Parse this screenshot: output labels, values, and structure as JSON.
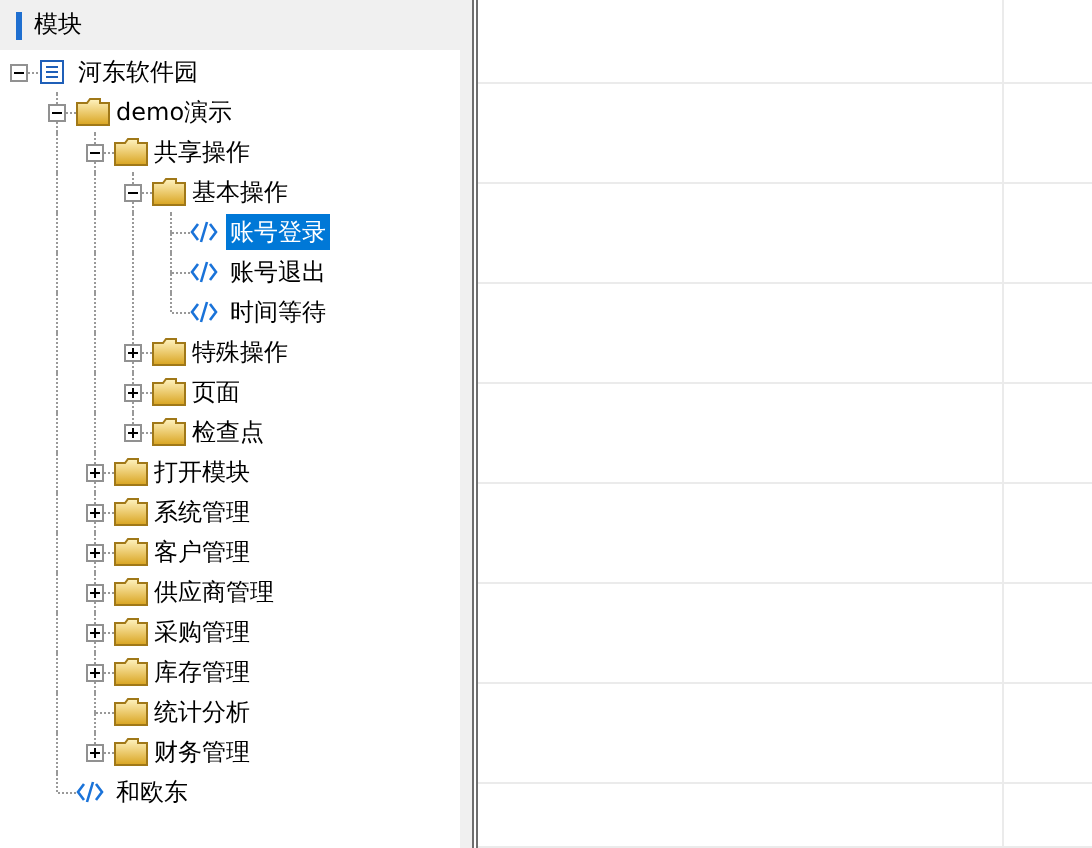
{
  "panel": {
    "title": "模块"
  },
  "tree": [
    {
      "label": "河东软件园",
      "kind": "list",
      "expanded": true,
      "selected": false,
      "children": [
        {
          "label": "demo演示",
          "kind": "folder",
          "expanded": true,
          "selected": false,
          "children": [
            {
              "label": "共享操作",
              "kind": "folder",
              "expanded": true,
              "selected": false,
              "children": [
                {
                  "label": "基本操作",
                  "kind": "folder",
                  "expanded": true,
                  "selected": false,
                  "children": [
                    {
                      "label": "账号登录",
                      "kind": "code",
                      "selected": true
                    },
                    {
                      "label": "账号退出",
                      "kind": "code",
                      "selected": false
                    },
                    {
                      "label": "时间等待",
                      "kind": "code",
                      "selected": false
                    }
                  ]
                },
                {
                  "label": "特殊操作",
                  "kind": "folder",
                  "expanded": false,
                  "selected": false
                },
                {
                  "label": "页面",
                  "kind": "folder",
                  "expanded": false,
                  "selected": false
                },
                {
                  "label": "检查点",
                  "kind": "folder",
                  "expanded": false,
                  "selected": false
                }
              ]
            },
            {
              "label": "打开模块",
              "kind": "folder",
              "expanded": false,
              "selected": false
            },
            {
              "label": "系统管理",
              "kind": "folder",
              "expanded": false,
              "selected": false
            },
            {
              "label": "客户管理",
              "kind": "folder",
              "expanded": false,
              "selected": false
            },
            {
              "label": "供应商管理",
              "kind": "folder",
              "expanded": false,
              "selected": false
            },
            {
              "label": "采购管理",
              "kind": "folder",
              "expanded": false,
              "selected": false
            },
            {
              "label": "库存管理",
              "kind": "folder",
              "expanded": false,
              "selected": false
            },
            {
              "label": "统计分析",
              "kind": "folder",
              "selected": false
            },
            {
              "label": "财务管理",
              "kind": "folder",
              "expanded": false,
              "selected": false
            }
          ]
        },
        {
          "label": "和欧东",
          "kind": "code",
          "selected": false
        }
      ]
    }
  ]
}
